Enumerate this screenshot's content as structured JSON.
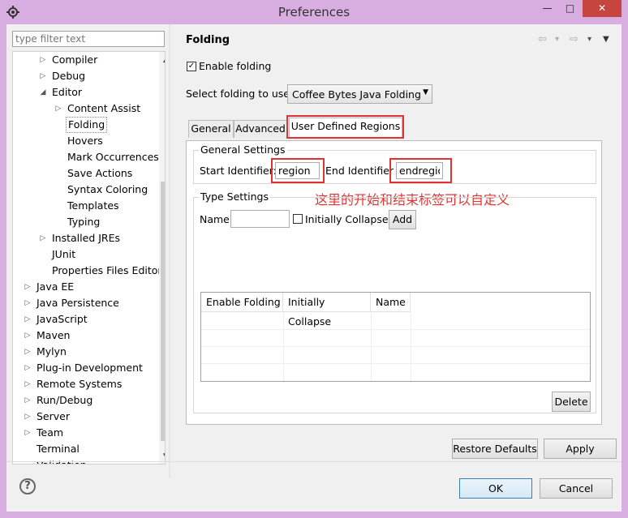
{
  "window": {
    "title": "Preferences",
    "minimize": "—",
    "maximize": "□",
    "close": "✕"
  },
  "filter": {
    "placeholder": "type filter text"
  },
  "tree": {
    "items": [
      {
        "label": "Compiler",
        "arrow": "▷"
      },
      {
        "label": "Debug",
        "arrow": "▷"
      },
      {
        "label": "Editor",
        "arrow": "◢"
      },
      {
        "label": "Content Assist",
        "arrow": "▷"
      },
      {
        "label": "Folding",
        "arrow": ""
      },
      {
        "label": "Hovers",
        "arrow": ""
      },
      {
        "label": "Mark Occurrences",
        "arrow": ""
      },
      {
        "label": "Save Actions",
        "arrow": ""
      },
      {
        "label": "Syntax Coloring",
        "arrow": ""
      },
      {
        "label": "Templates",
        "arrow": ""
      },
      {
        "label": "Typing",
        "arrow": ""
      },
      {
        "label": "Installed JREs",
        "arrow": "▷"
      },
      {
        "label": "JUnit",
        "arrow": ""
      },
      {
        "label": "Properties Files Editor",
        "arrow": ""
      },
      {
        "label": "Java EE",
        "arrow": "▷"
      },
      {
        "label": "Java Persistence",
        "arrow": "▷"
      },
      {
        "label": "JavaScript",
        "arrow": "▷"
      },
      {
        "label": "Maven",
        "arrow": "▷"
      },
      {
        "label": "Mylyn",
        "arrow": "▷"
      },
      {
        "label": "Plug-in Development",
        "arrow": "▷"
      },
      {
        "label": "Remote Systems",
        "arrow": "▷"
      },
      {
        "label": "Run/Debug",
        "arrow": "▷"
      },
      {
        "label": "Server",
        "arrow": "▷"
      },
      {
        "label": "Team",
        "arrow": "▷"
      },
      {
        "label": "Terminal",
        "arrow": ""
      },
      {
        "label": "Validation",
        "arrow": ""
      }
    ],
    "selected": "Folding"
  },
  "page": {
    "title": "Folding",
    "nav_back": "⇦",
    "nav_back_menu": "▾",
    "nav_fwd": "⇨",
    "nav_fwd_menu": "▾",
    "view_menu": "▼",
    "enable_folding_label": "Enable folding",
    "enable_folding_checked": true,
    "select_folding_label": "Select folding to use:",
    "folding_selected": "Coffee Bytes Java Folding",
    "tabs": [
      {
        "label": "General"
      },
      {
        "label": "Advanced"
      },
      {
        "label": "User Defined Regions"
      }
    ],
    "active_tab": "User Defined Regions",
    "general_settings": {
      "title": "General Settings",
      "start_label": "Start Identifier:",
      "start_value": "region",
      "end_label": "End Identifier",
      "end_value": "endregio"
    },
    "annotation": "这里的开始和结束标签可以自定义",
    "type_settings": {
      "title": "Type Settings",
      "name_label": "Name",
      "name_value": "",
      "initially_collapse_label": "Initially Collapse",
      "add_button": "Add"
    },
    "table": {
      "columns": [
        "Enable Folding",
        "Initially Collapse",
        "Name"
      ],
      "rows": []
    },
    "delete_button": "Delete",
    "restore_defaults_button": "Restore Defaults",
    "apply_button": "Apply"
  },
  "footer": {
    "help": "?",
    "ok_button": "OK",
    "cancel_button": "Cancel"
  },
  "colors": {
    "frame": "#d8aee0",
    "close_button": "#c7453f",
    "annotation_red": "#e03434"
  }
}
